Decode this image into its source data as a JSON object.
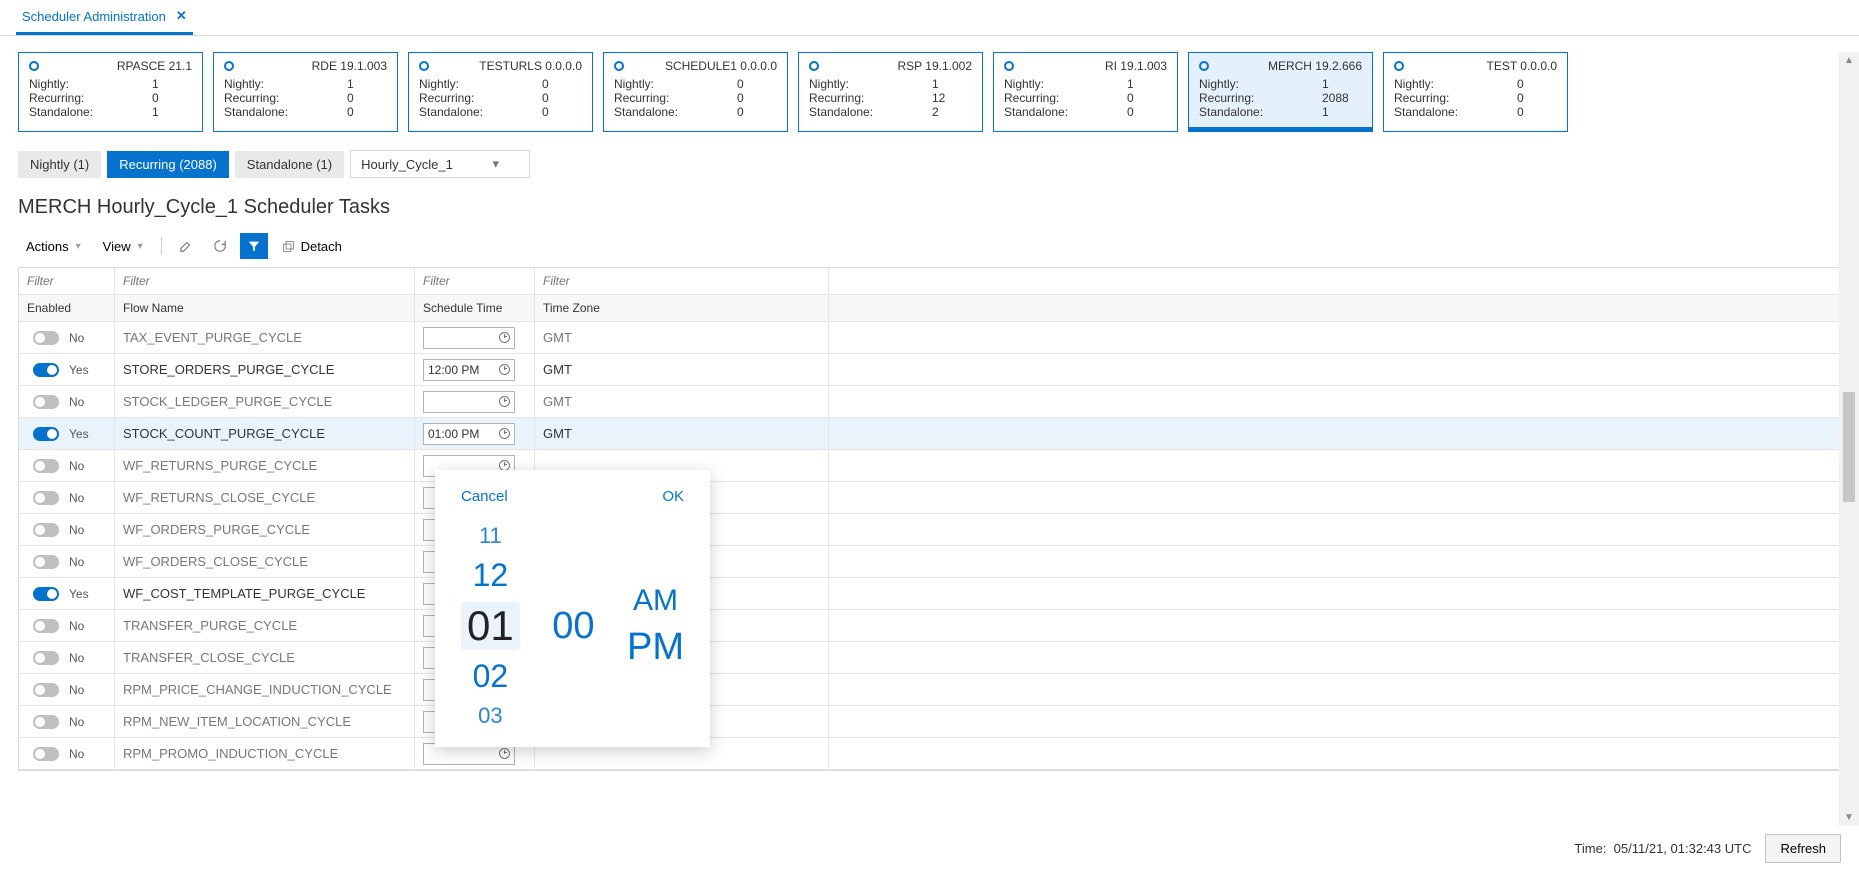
{
  "tab": {
    "label": "Scheduler Administration"
  },
  "cards": [
    {
      "title": "RPASCE 21.1",
      "nightly": "1",
      "recurring": "0",
      "standalone": "1"
    },
    {
      "title": "RDE 19.1.003",
      "nightly": "1",
      "recurring": "0",
      "standalone": "0"
    },
    {
      "title": "TESTURLS 0.0.0.0",
      "nightly": "0",
      "recurring": "0",
      "standalone": "0"
    },
    {
      "title": "SCHEDULE1 0.0.0.0",
      "nightly": "0",
      "recurring": "0",
      "standalone": "0"
    },
    {
      "title": "RSP 19.1.002",
      "nightly": "1",
      "recurring": "12",
      "standalone": "2"
    },
    {
      "title": "RI 19.1.003",
      "nightly": "1",
      "recurring": "0",
      "standalone": "0"
    },
    {
      "title": "MERCH 19.2.666",
      "nightly": "1",
      "recurring": "2088",
      "standalone": "1",
      "selected": true
    },
    {
      "title": "TEST 0.0.0.0",
      "nightly": "0",
      "recurring": "0",
      "standalone": "0"
    }
  ],
  "card_labels": {
    "nightly": "Nightly:",
    "recurring": "Recurring:",
    "standalone": "Standalone:"
  },
  "sub_tabs": {
    "nightly": "Nightly (1)",
    "recurring": "Recurring (2088)",
    "standalone": "Standalone (1)",
    "dropdown": "Hourly_Cycle_1"
  },
  "page_title": "MERCH Hourly_Cycle_1 Scheduler Tasks",
  "toolbar": {
    "actions": "Actions",
    "view": "View",
    "detach": "Detach"
  },
  "grid": {
    "filter_placeholder": "Filter",
    "headers": {
      "enabled": "Enabled",
      "flow": "Flow Name",
      "sched": "Schedule Time",
      "tz": "Time Zone"
    },
    "rows": [
      {
        "enabled": false,
        "label": "No",
        "flow": "TAX_EVENT_PURGE_CYCLE",
        "time": "",
        "tz": "GMT"
      },
      {
        "enabled": true,
        "label": "Yes",
        "flow": "STORE_ORDERS_PURGE_CYCLE",
        "time": "12:00 PM",
        "tz": "GMT"
      },
      {
        "enabled": false,
        "label": "No",
        "flow": "STOCK_LEDGER_PURGE_CYCLE",
        "time": "",
        "tz": "GMT"
      },
      {
        "enabled": true,
        "label": "Yes",
        "flow": "STOCK_COUNT_PURGE_CYCLE",
        "time": "01:00 PM",
        "tz": "GMT",
        "selected": true
      },
      {
        "enabled": false,
        "label": "No",
        "flow": "WF_RETURNS_PURGE_CYCLE",
        "time": "",
        "tz": ""
      },
      {
        "enabled": false,
        "label": "No",
        "flow": "WF_RETURNS_CLOSE_CYCLE",
        "time": "",
        "tz": ""
      },
      {
        "enabled": false,
        "label": "No",
        "flow": "WF_ORDERS_PURGE_CYCLE",
        "time": "",
        "tz": ""
      },
      {
        "enabled": false,
        "label": "No",
        "flow": "WF_ORDERS_CLOSE_CYCLE",
        "time": "",
        "tz": ""
      },
      {
        "enabled": true,
        "label": "Yes",
        "flow": "WF_COST_TEMPLATE_PURGE_CYCLE",
        "time": "",
        "tz": ""
      },
      {
        "enabled": false,
        "label": "No",
        "flow": "TRANSFER_PURGE_CYCLE",
        "time": "",
        "tz": ""
      },
      {
        "enabled": false,
        "label": "No",
        "flow": "TRANSFER_CLOSE_CYCLE",
        "time": "",
        "tz": ""
      },
      {
        "enabled": false,
        "label": "No",
        "flow": "RPM_PRICE_CHANGE_INDUCTION_CYCLE",
        "time": "",
        "tz": ""
      },
      {
        "enabled": false,
        "label": "No",
        "flow": "RPM_NEW_ITEM_LOCATION_CYCLE",
        "time": "",
        "tz": ""
      },
      {
        "enabled": false,
        "label": "No",
        "flow": "RPM_PROMO_INDUCTION_CYCLE",
        "time": "",
        "tz": ""
      }
    ]
  },
  "time_picker": {
    "cancel": "Cancel",
    "ok": "OK",
    "hours": [
      "11",
      "12",
      "01",
      "02",
      "03"
    ],
    "minutes": "00",
    "am": "AM",
    "pm": "PM"
  },
  "status": {
    "time_label": "Time:",
    "time_value": "05/11/21, 01:32:43 UTC",
    "refresh": "Refresh"
  }
}
